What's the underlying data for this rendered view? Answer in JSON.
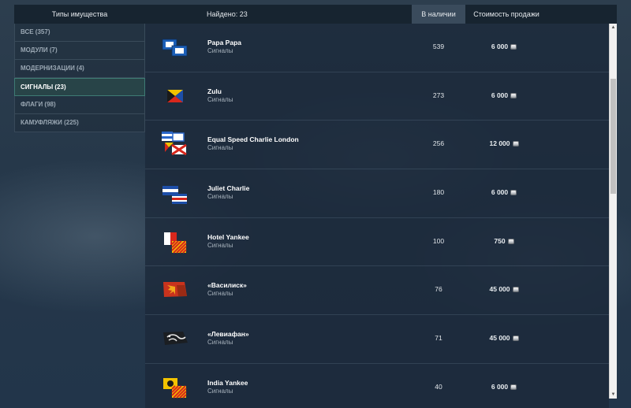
{
  "header": {
    "types_label": "Типы имущества",
    "found_label": "Найдено: 23",
    "stock_label": "В наличии",
    "price_label": "Стоимость продажи"
  },
  "sidebar": {
    "items": [
      {
        "label": "ВСЕ (357)",
        "active": false
      },
      {
        "label": "МОДУЛИ (7)",
        "active": false
      },
      {
        "label": "МОДЕРНИЗАЦИИ (4)",
        "active": false
      },
      {
        "label": "СИГНАЛЫ (23)",
        "active": true
      },
      {
        "label": "ФЛАГИ (98)",
        "active": false
      },
      {
        "label": "КАМУФЛЯЖИ (225)",
        "active": false
      }
    ]
  },
  "items": [
    {
      "name": "Papa Papa",
      "type": "Сигналы",
      "stock": "539",
      "price": "6 000",
      "icon": "papa-papa-flags-icon"
    },
    {
      "name": "Zulu",
      "type": "Сигналы",
      "stock": "273",
      "price": "6 000",
      "icon": "zulu-flag-icon"
    },
    {
      "name": "Equal Speed Charlie London",
      "type": "Сигналы",
      "stock": "256",
      "price": "12 000",
      "icon": "equal-speed-charlie-london-flags-icon"
    },
    {
      "name": "Juliet Charlie",
      "type": "Сигналы",
      "stock": "180",
      "price": "6 000",
      "icon": "juliet-charlie-flags-icon"
    },
    {
      "name": "Hotel Yankee",
      "type": "Сигналы",
      "stock": "100",
      "price": "750",
      "icon": "hotel-yankee-flags-icon"
    },
    {
      "name": "«Василиск»",
      "type": "Сигналы",
      "stock": "76",
      "price": "45 000",
      "icon": "basilisk-flag-icon"
    },
    {
      "name": "«Левиафан»",
      "type": "Сигналы",
      "stock": "71",
      "price": "45 000",
      "icon": "leviathan-flag-icon"
    },
    {
      "name": "India Yankee",
      "type": "Сигналы",
      "stock": "40",
      "price": "6 000",
      "icon": "india-yankee-flags-icon"
    }
  ],
  "colors": {
    "active_border": "#3e7b74",
    "header_bg": "#14202c"
  }
}
